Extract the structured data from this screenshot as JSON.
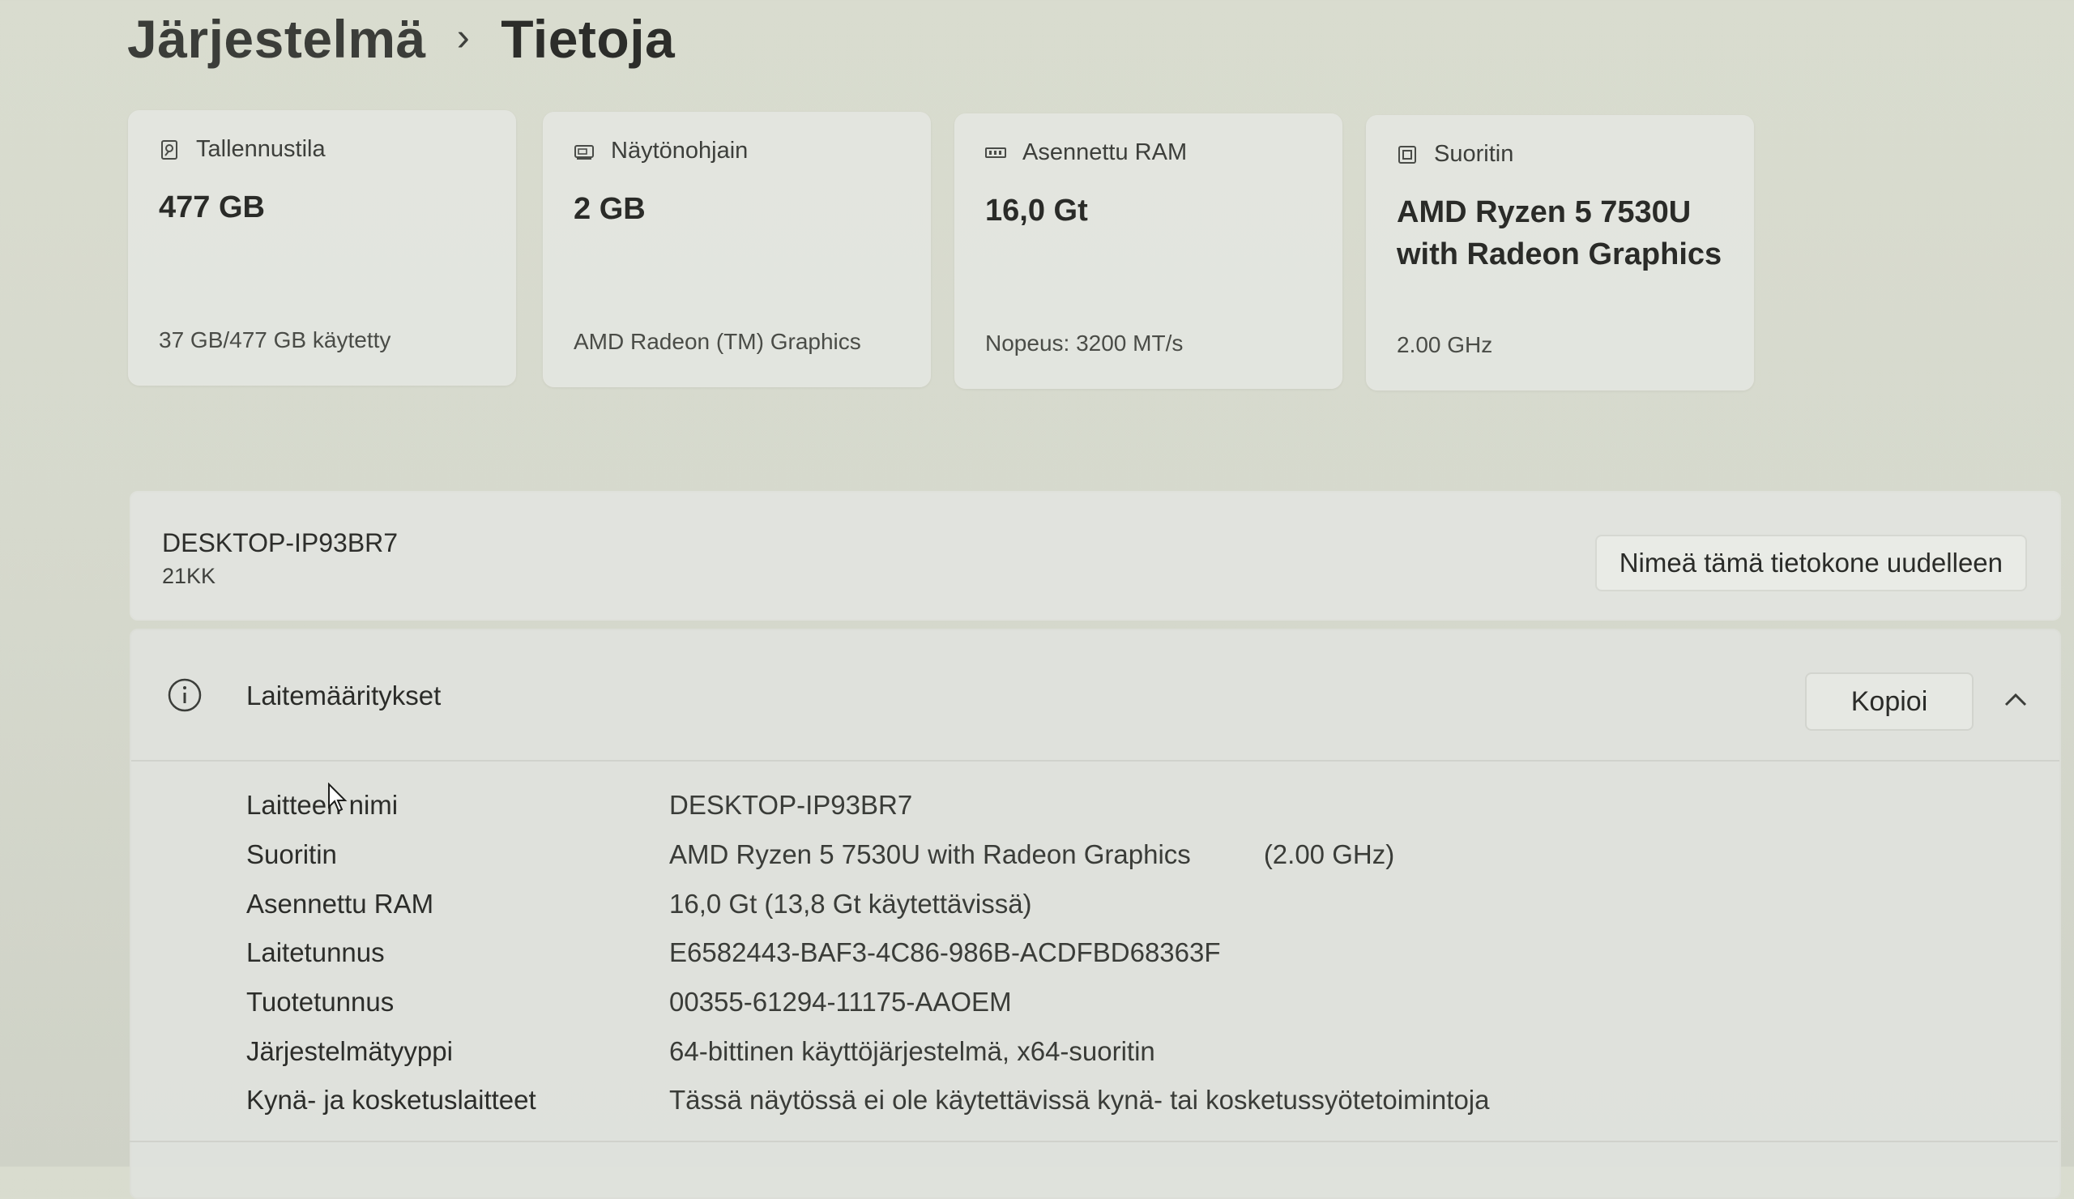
{
  "breadcrumb": {
    "parent": "Järjestelmä",
    "separator": "›",
    "current": "Tietoja"
  },
  "cards": [
    {
      "title": "Tallennustila",
      "value": "477 GB",
      "sub": "37 GB/477 GB käytetty",
      "icon": "storage-icon"
    },
    {
      "title": "Näytönohjain",
      "value": "2 GB",
      "sub": "AMD Radeon (TM) Graphics",
      "icon": "display-adapter-icon"
    },
    {
      "title": "Asennettu RAM",
      "value": "16,0 Gt",
      "sub": "Nopeus: 3200 MT/s",
      "icon": "ram-icon"
    },
    {
      "title": "Suoritin",
      "value": "AMD Ryzen 5 7530U with Radeon Graphics",
      "sub": "2.00 GHz",
      "icon": "processor-icon"
    }
  ],
  "device": {
    "name": "DESKTOP-IP93BR7",
    "model": "21KK",
    "rename_label": "Nimeä tämä tietokone uudelleen"
  },
  "specs": {
    "title": "Laitemääritykset",
    "copy_label": "Kopioi",
    "rows": [
      {
        "label": "Laitteen nimi",
        "value": "DESKTOP-IP93BR7",
        "extra": ""
      },
      {
        "label": "Suoritin",
        "value": "AMD Ryzen 5 7530U with Radeon Graphics",
        "extra": "(2.00 GHz)"
      },
      {
        "label": "Asennettu RAM",
        "value": "16,0 Gt (13,8 Gt käytettävissä)",
        "extra": ""
      },
      {
        "label": "Laitetunnus",
        "value": "E6582443-BAF3-4C86-986B-ACDFBD68363F",
        "extra": ""
      },
      {
        "label": "Tuotetunnus",
        "value": "00355-61294-11175-AAOEM",
        "extra": ""
      },
      {
        "label": "Järjestelmätyyppi",
        "value": "64-bittinen käyttöjärjestelmä, x64-suoritin",
        "extra": ""
      },
      {
        "label": "Kynä- ja kosketuslaitteet",
        "value": "Tässä näytössä ei ole käytettävissä kynä- tai kosketussyötetoimintoja",
        "extra": ""
      }
    ]
  },
  "colors": {
    "background": "#d8dbcf",
    "card": "#e4e6e1",
    "text": "#2b2c2a"
  }
}
